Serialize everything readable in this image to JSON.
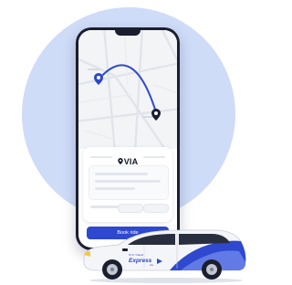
{
  "app": {
    "brand_name": "VIA",
    "book_button_label": "Book ride"
  },
  "car": {
    "decal_top": "NYC Transit",
    "decal_name": "Express",
    "decal_bottom": "via"
  },
  "colors": {
    "background_circle": "#cfdcf8",
    "phone_frame": "#1b1e2e",
    "route_line": "#2e48cf",
    "button": "#2e48cf",
    "car_body": "#f4f5f8",
    "car_accent": "#2e48cf",
    "pin": "#1b1e2e"
  },
  "icons": {
    "origin": "map-pin-icon",
    "destination": "map-pin-icon",
    "brand": "location-pin-icon"
  }
}
